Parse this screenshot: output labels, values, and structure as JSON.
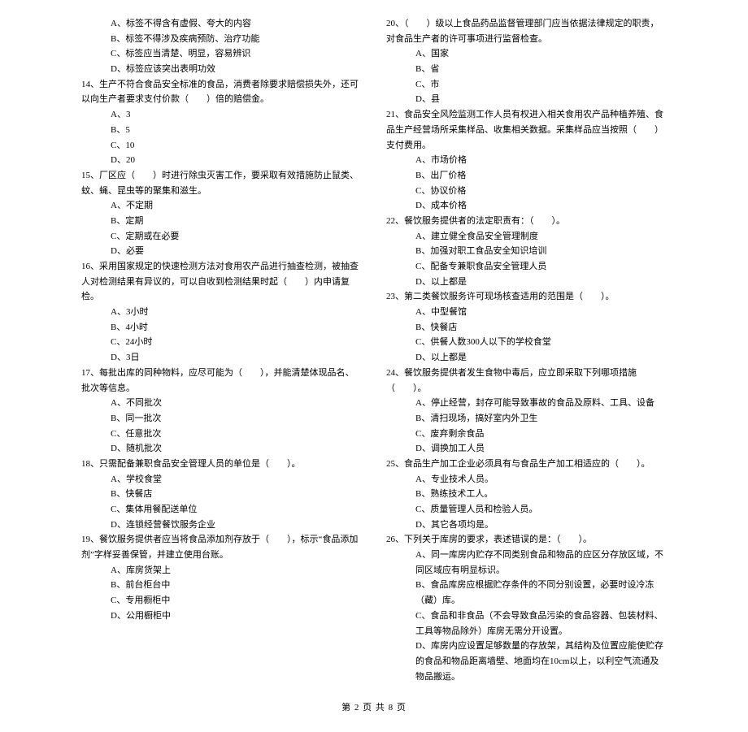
{
  "left": {
    "pre_opts": [
      "A、标签不得含有虚假、夸大的内容",
      "B、标签不得涉及疾病预防、治疗功能",
      "C、标签应当清楚、明显，容易辨识",
      "D、标签应该突出表明功效"
    ],
    "q14": "14、生产不符合食品安全标准的食品，消费者除要求赔偿损失外，还可以向生产者要求支付价款（　　）倍的赔偿金。",
    "q14_opts": [
      "A、3",
      "B、5",
      "C、10",
      "D、20"
    ],
    "q15": "15、厂区应（　　）时进行除虫灭害工作，要采取有效措施防止鼠类、蚊、蝇、昆虫等的聚集和滋生。",
    "q15_opts": [
      "A、不定期",
      "B、定期",
      "C、定期或在必要",
      "D、必要"
    ],
    "q16": "16、采用国家规定的快速检测方法对食用农产品进行抽查检测，被抽查人对检测结果有异议的，可以自收到检测结果时起（　　）内申请复检。",
    "q16_opts": [
      "A、3小时",
      "B、4小时",
      "C、24小时",
      "D、3日"
    ],
    "q17": "17、每批出库的同种物料，应尽可能为（　　），并能清楚体现品名、批次等信息。",
    "q17_opts": [
      "A、不同批次",
      "B、同一批次",
      "C、任意批次",
      "D、随机批次"
    ],
    "q18": "18、只需配备兼职食品安全管理人员的单位是（　　）。",
    "q18_opts": [
      "A、学校食堂",
      "B、快餐店",
      "C、集体用餐配送单位",
      "D、连锁经营餐饮服务企业"
    ],
    "q19": "19、餐饮服务提供者应当将食品添加剂存放于（　　），标示“食品添加剂”字样妥善保管，并建立使用台账。",
    "q19_opts": [
      "A、库房货架上",
      "B、前台柜台中",
      "C、专用橱柜中",
      "D、公用橱柜中"
    ]
  },
  "right": {
    "q20": "20、（　　）级以上食品药品监督管理部门应当依据法律规定的职责，对食品生产者的许可事项进行监督检查。",
    "q20_opts": [
      "A、国家",
      "B、省",
      "C、市",
      "D、县"
    ],
    "q21": "21、食品安全风险监测工作人员有权进入相关食用农产品种植养殖、食品生产经营场所采集样品、收集相关数据。采集样品应当按照（　　）支付费用。",
    "q21_opts": [
      "A、市场价格",
      "B、出厂价格",
      "C、协议价格",
      "D、成本价格"
    ],
    "q22": "22、餐饮服务提供者的法定职责有：（　　）。",
    "q22_opts": [
      "A、建立健全食品安全管理制度",
      "B、加强对职工食品安全知识培训",
      "C、配备专兼职食品安全管理人员",
      "D、以上都是"
    ],
    "q23": "23、第二类餐饮服务许可现场核查适用的范围是（　　）。",
    "q23_opts": [
      "A、中型餐馆",
      "B、快餐店",
      "C、供餐人数300人以下的学校食堂",
      "D、以上都是"
    ],
    "q24": "24、餐饮服务提供者发生食物中毒后，应立即采取下列哪项措施（　　）。",
    "q24_opts": [
      "A、停止经营，封存可能导致事故的食品及原料、工具、设备",
      "B、清扫现场，搞好室内外卫生",
      "C、废弃剩余食品",
      "D、调换加工人员"
    ],
    "q25": "25、食品生产加工企业必须具有与食品生产加工相适应的（　　）。",
    "q25_opts": [
      "A、专业技术人员。",
      "B、熟练技术工人。",
      "C、质量管理人员和检验人员。",
      "D、其它各项均是。"
    ],
    "q26": "26、下列关于库房的要求，表述错误的是：（　　）。",
    "q26_opts": [
      "A、同一库房内贮存不同类别食品和物品的应区分存放区域，不同区域应有明显标识。",
      "B、食品库房应根据贮存条件的不同分别设置，必要时设冷冻（藏）库。",
      "C、食品和非食品（不会导致食品污染的食品容器、包装材料、工具等物品除外）库房无需分开设置。",
      "D、库房内应设置足够数量的存放架，其结构及位置应能使贮存的食品和物品距离墙壁、地面均在10cm以上，以利空气流通及物品搬运。"
    ]
  },
  "footer": "第 2 页 共 8 页"
}
